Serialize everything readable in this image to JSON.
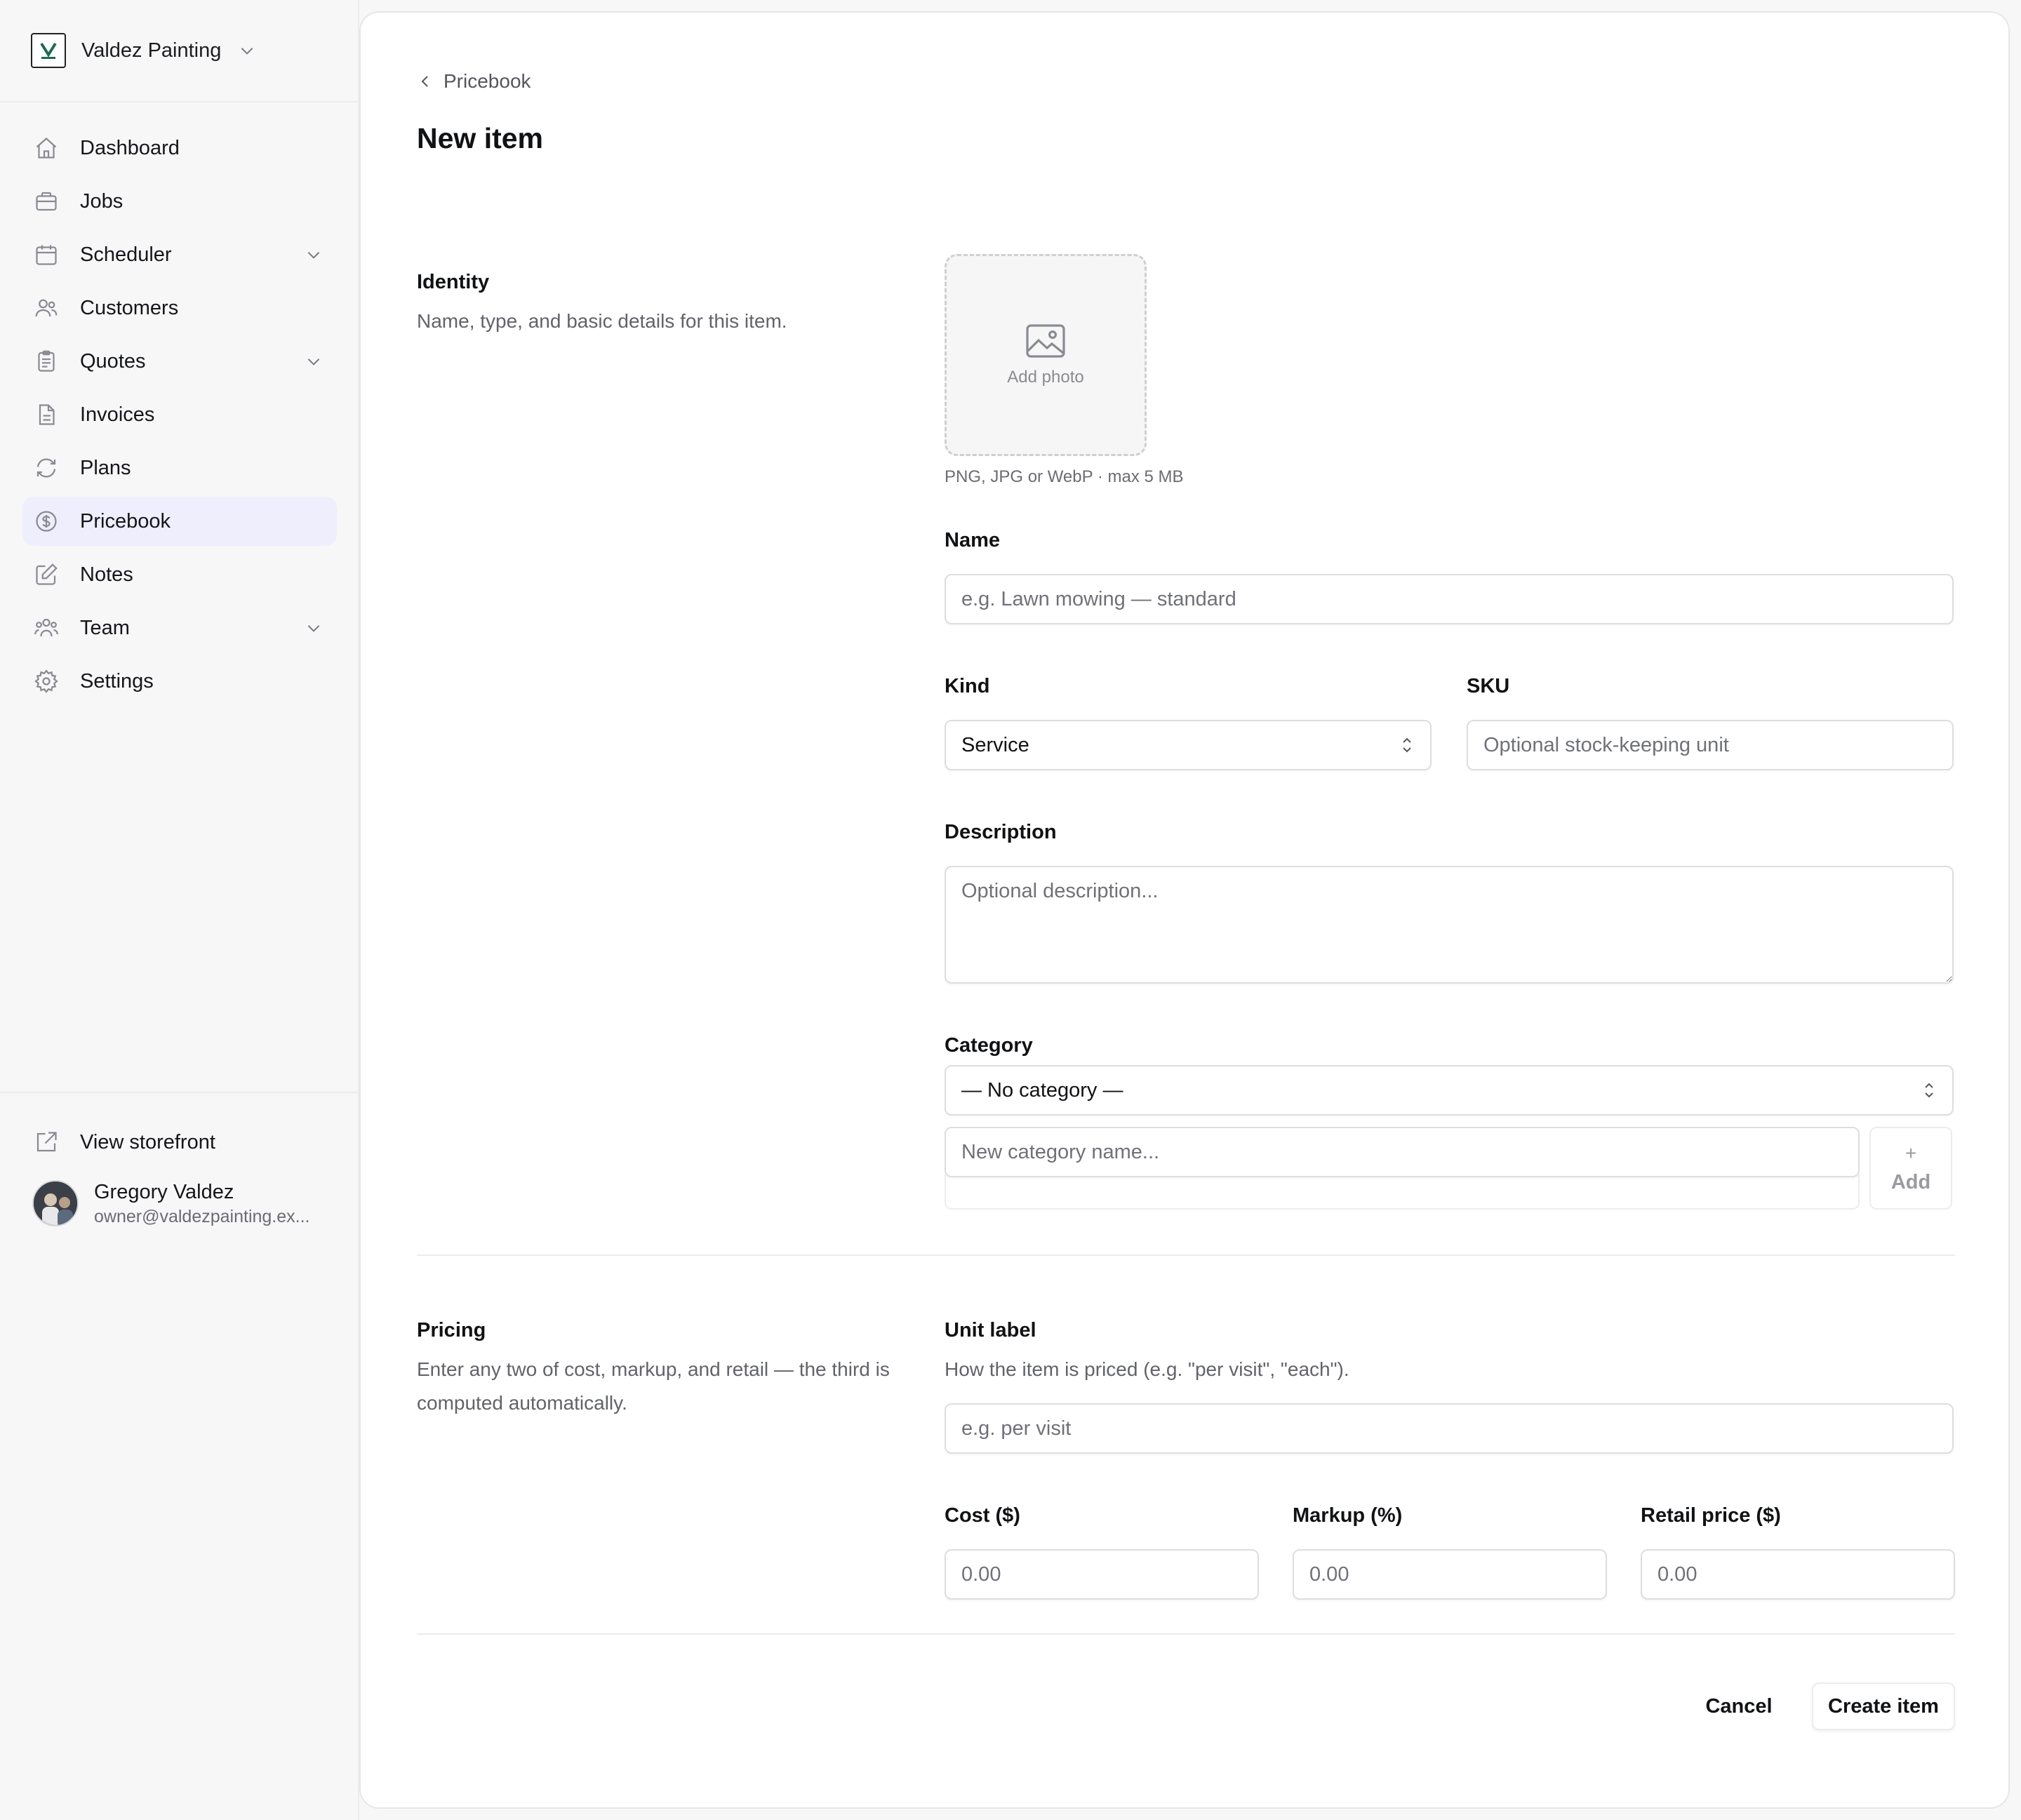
{
  "workspace": {
    "name": "Valdez Painting",
    "logo_text": "V"
  },
  "sidebar": {
    "items": [
      {
        "label": "Dashboard",
        "icon": "home-icon",
        "has_chevron": false,
        "active": false
      },
      {
        "label": "Jobs",
        "icon": "briefcase-icon",
        "has_chevron": false,
        "active": false
      },
      {
        "label": "Scheduler",
        "icon": "calendar-icon",
        "has_chevron": true,
        "active": false
      },
      {
        "label": "Customers",
        "icon": "users-icon",
        "has_chevron": false,
        "active": false
      },
      {
        "label": "Quotes",
        "icon": "clipboard-icon",
        "has_chevron": true,
        "active": false
      },
      {
        "label": "Invoices",
        "icon": "document-icon",
        "has_chevron": false,
        "active": false
      },
      {
        "label": "Plans",
        "icon": "refresh-icon",
        "has_chevron": false,
        "active": false
      },
      {
        "label": "Pricebook",
        "icon": "dollar-circle-icon",
        "has_chevron": false,
        "active": true
      },
      {
        "label": "Notes",
        "icon": "pencil-square-icon",
        "has_chevron": false,
        "active": false
      },
      {
        "label": "Team",
        "icon": "team-icon",
        "has_chevron": true,
        "active": false
      },
      {
        "label": "Settings",
        "icon": "gear-icon",
        "has_chevron": false,
        "active": false
      }
    ],
    "storefront_label": "View storefront",
    "user": {
      "name": "Gregory Valdez",
      "email": "owner@valdezpainting.ex..."
    }
  },
  "breadcrumb": {
    "label": "Pricebook"
  },
  "page": {
    "title": "New item"
  },
  "identity": {
    "title": "Identity",
    "description": "Name, type, and basic details for this item.",
    "photo": {
      "label": "Add photo",
      "hint": "PNG, JPG or WebP · max 5 MB"
    },
    "name": {
      "label": "Name",
      "placeholder": "e.g. Lawn mowing — standard",
      "value": ""
    },
    "kind": {
      "label": "Kind",
      "value": "Service"
    },
    "sku": {
      "label": "SKU",
      "placeholder": "Optional stock-keeping unit",
      "value": ""
    },
    "description_field": {
      "label": "Description",
      "placeholder": "Optional description...",
      "value": ""
    },
    "category": {
      "label": "Category",
      "value": "— No category —",
      "new_placeholder": "New category name...",
      "add_plus": "+",
      "add_label": "Add"
    }
  },
  "pricing": {
    "title": "Pricing",
    "description": "Enter any two of cost, markup, and retail — the third is computed automatically.",
    "unit_label": {
      "label": "Unit label",
      "help": "How the item is priced (e.g. \"per visit\", \"each\").",
      "placeholder": "e.g. per visit"
    },
    "cost": {
      "label": "Cost ($)",
      "placeholder": "0.00"
    },
    "markup": {
      "label": "Markup (%)",
      "placeholder": "0.00"
    },
    "retail": {
      "label": "Retail price ($)",
      "placeholder": "0.00"
    }
  },
  "actions": {
    "cancel_label": "Cancel",
    "create_label": "Create item"
  },
  "colors": {
    "active_nav_bg": "#eeeefd",
    "page_bg": "#f7f7f8",
    "card_bg": "#ffffff",
    "border": "#dedee2"
  }
}
